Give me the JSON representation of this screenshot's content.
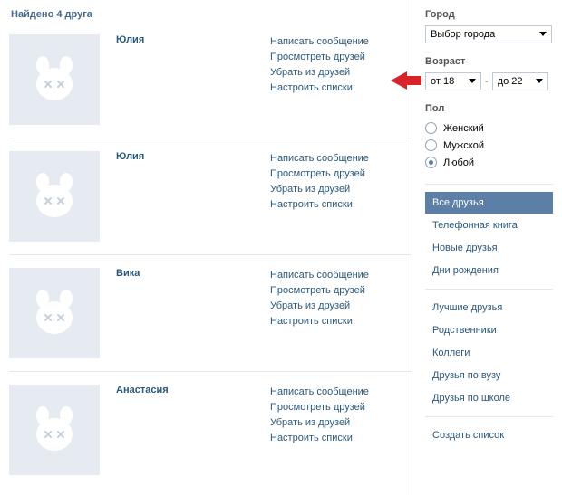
{
  "heading": "Найдено 4 друга",
  "friends": [
    {
      "name": "Юлия"
    },
    {
      "name": "Юлия"
    },
    {
      "name": "Вика"
    },
    {
      "name": "Анастасия"
    }
  ],
  "actions": {
    "write": "Написать сообщение",
    "viewFriends": "Просмотреть друзей",
    "remove": "Убрать из друзей",
    "lists": "Настроить списки"
  },
  "filters": {
    "cityLabel": "Город",
    "citySelected": "Выбор города",
    "ageLabel": "Возраст",
    "ageFrom": "от 18",
    "ageTo": "до 22",
    "genderLabel": "Пол",
    "gender": {
      "female": "Женский",
      "male": "Мужской",
      "any": "Любой"
    }
  },
  "nav": {
    "group1": [
      "Все друзья",
      "Телефонная книга",
      "Новые друзья",
      "Дни рождения"
    ],
    "group2": [
      "Лучшие друзья",
      "Родственники",
      "Коллеги",
      "Друзья по вузу",
      "Друзья по школе"
    ],
    "group3": [
      "Создать список"
    ],
    "activeIndex": 0
  }
}
